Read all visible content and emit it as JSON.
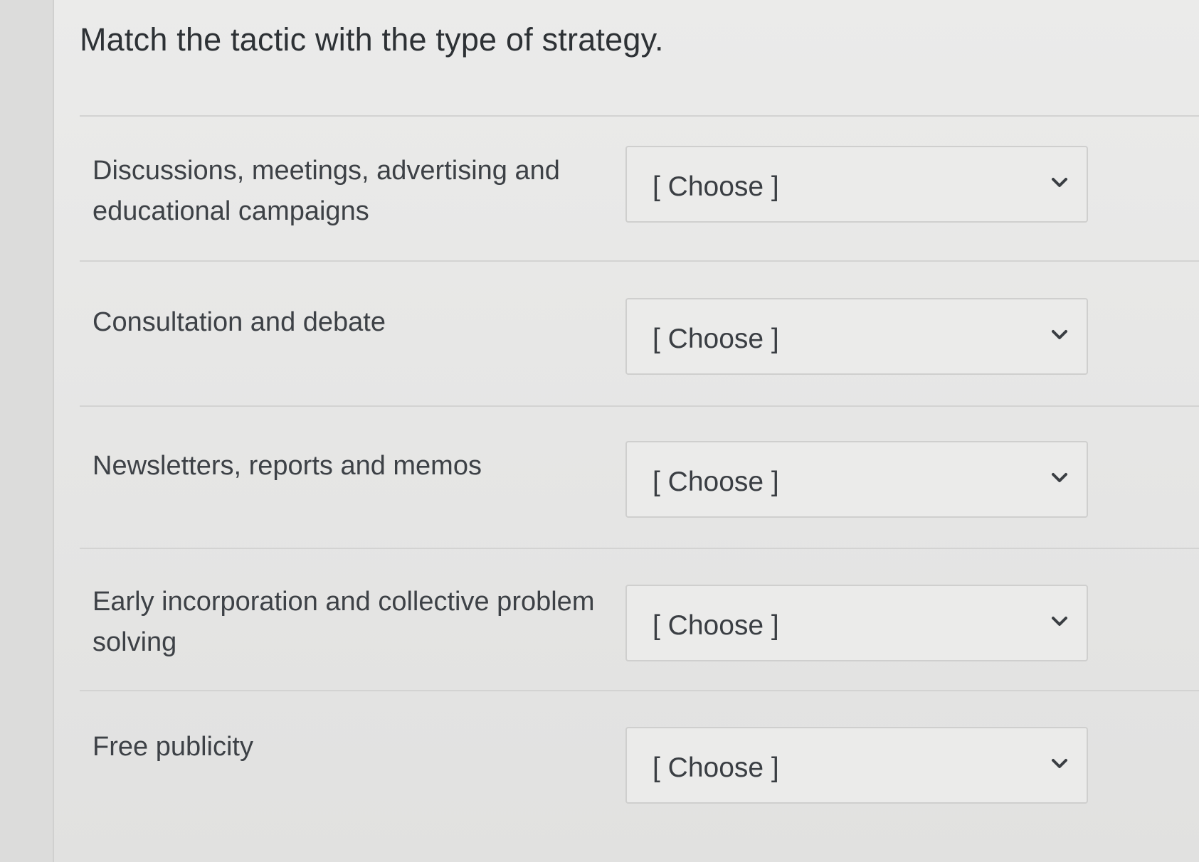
{
  "title": "Match the tactic with the type of strategy.",
  "rows": [
    {
      "prompt": "Discussions, meetings, advertising and educational campaigns",
      "selected": "[ Choose ]"
    },
    {
      "prompt": "Consultation and debate",
      "selected": "[ Choose ]"
    },
    {
      "prompt": "Newsletters, reports and memos",
      "selected": "[ Choose ]"
    },
    {
      "prompt": "Early incorporation and collective problem solving",
      "selected": "[ Choose ]"
    },
    {
      "prompt": "Free publicity",
      "selected": "[ Choose ]"
    }
  ]
}
